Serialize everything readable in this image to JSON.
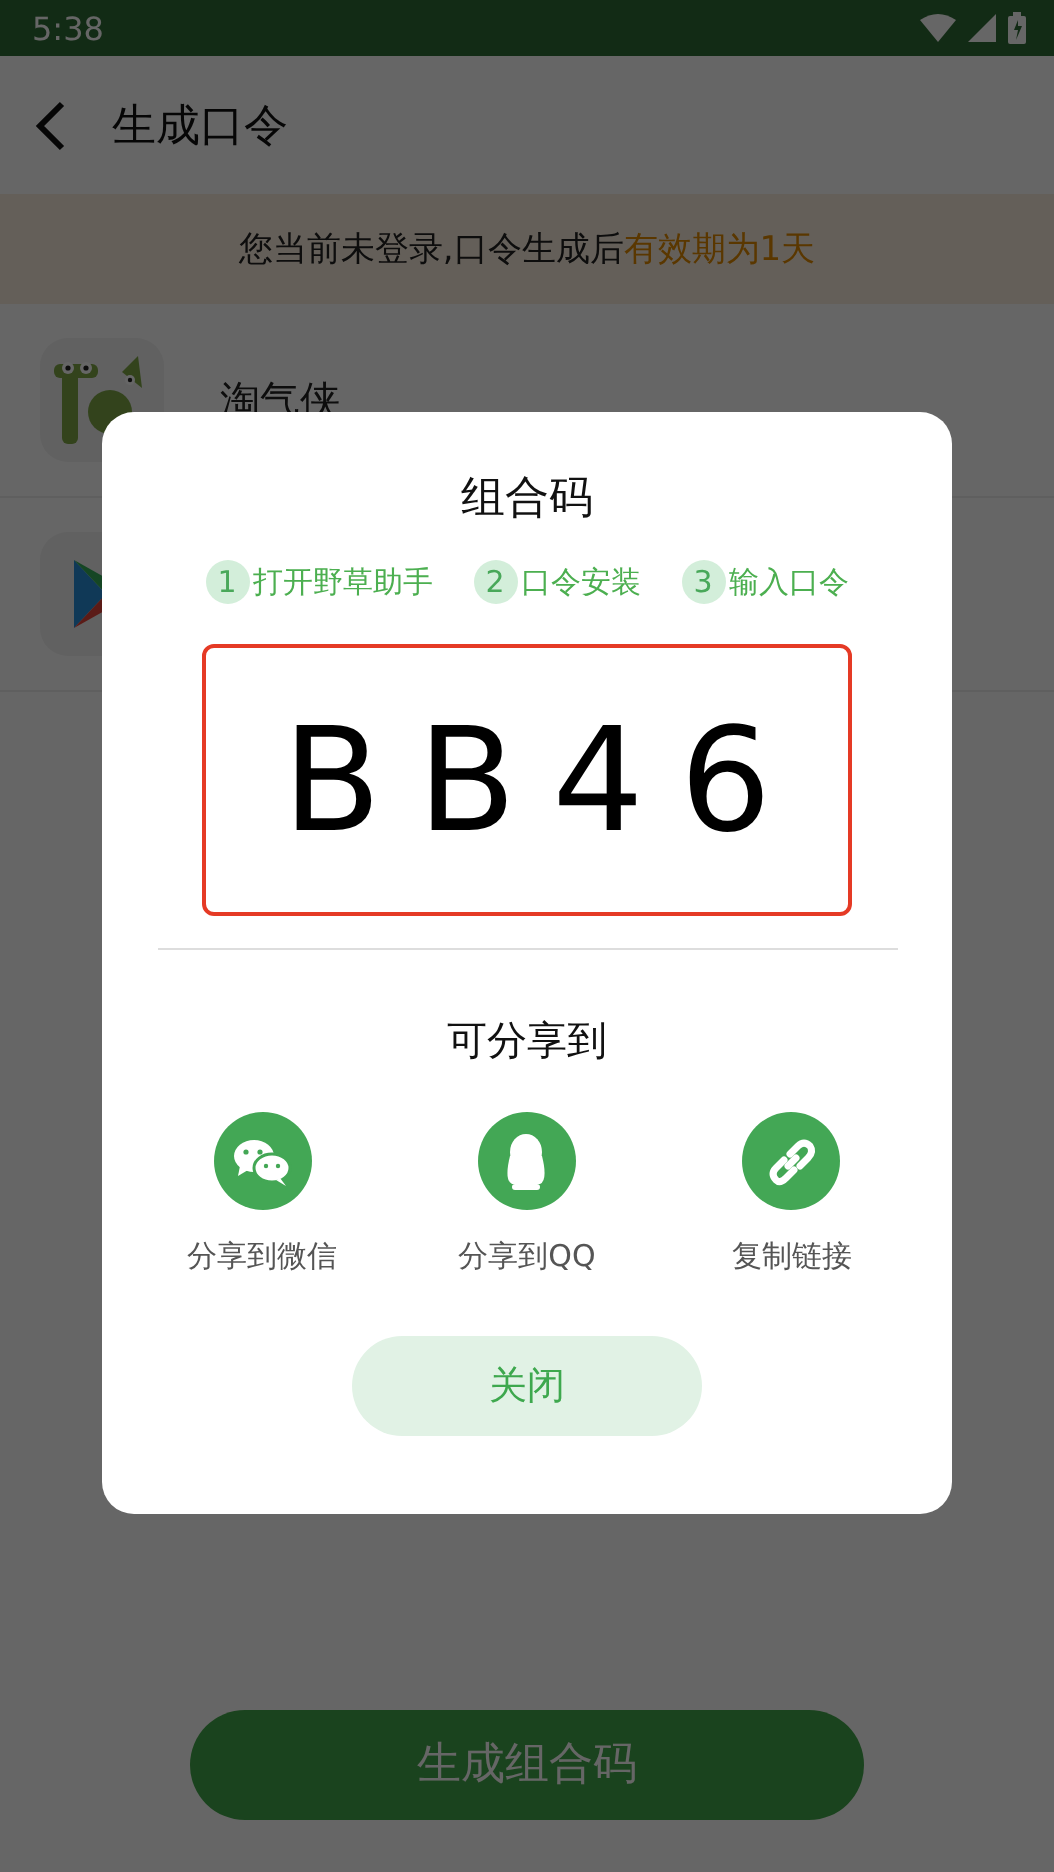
{
  "status_bar": {
    "time": "5:38"
  },
  "app_bar": {
    "title": "生成口令"
  },
  "notice": {
    "text": "您当前未登录,口令生成后",
    "highlight": "有效期为1天"
  },
  "apps": [
    {
      "name": "淘气侠",
      "kind": "toy"
    },
    {
      "kind": "play"
    }
  ],
  "generate_button": {
    "label": "生成组合码"
  },
  "dialog": {
    "title": "组合码",
    "steps": [
      {
        "number": "1",
        "label": "打开野草助手"
      },
      {
        "number": "2",
        "label": "口令安装"
      },
      {
        "number": "3",
        "label": "输入口令"
      }
    ],
    "code": "BB46",
    "share_title": "可分享到",
    "share_targets": [
      {
        "kind": "wechat",
        "label": "分享到微信"
      },
      {
        "kind": "qq",
        "label": "分享到QQ"
      },
      {
        "kind": "link",
        "label": "复制链接"
      }
    ],
    "close_button": "关闭"
  }
}
